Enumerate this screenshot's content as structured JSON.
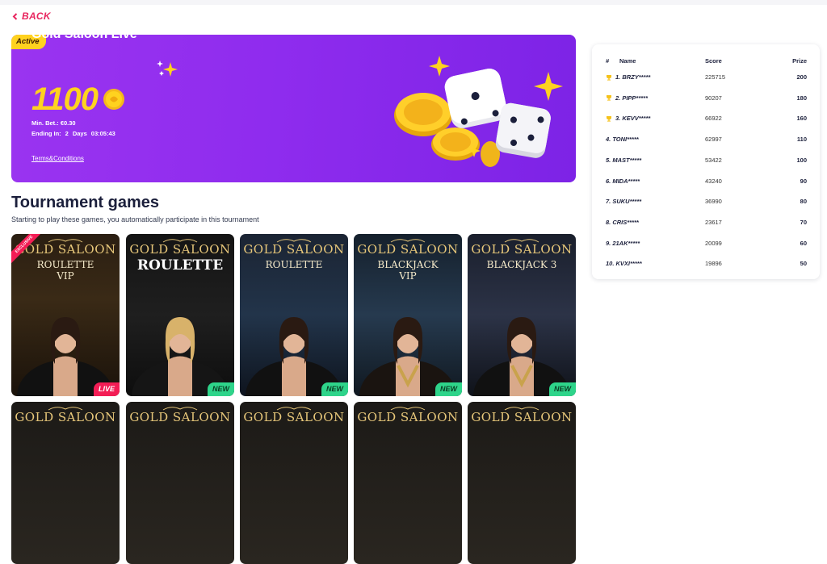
{
  "nav": {
    "back_label": "BACK"
  },
  "banner": {
    "badge": "Active",
    "title": "Gold Saloon Live",
    "amount": "1100",
    "min_bet": "Min. Bet.: €0.30",
    "ending_label": "Ending In:",
    "ending_days": "2",
    "ending_days_unit": "Days",
    "ending_time": "03:05:43",
    "terms_label": "Terms&Conditions"
  },
  "section": {
    "title": "Tournament games",
    "subtitle": "Starting to play these games, you automatically participate in this tournament"
  },
  "games": [
    {
      "brand": "GOLD SALOON",
      "name_line1": "ROULETTE",
      "name_line2": "VIP",
      "tag": "LIVE",
      "ribbon": "EXCLUSIVE"
    },
    {
      "brand": "GOLD SALOON",
      "name_line1": "ROULETTE",
      "name_line2": "",
      "tag": "NEW",
      "ribbon": ""
    },
    {
      "brand": "GOLD SALOON",
      "name_line1": "ROULETTE",
      "name_line2": "",
      "tag": "NEW",
      "ribbon": ""
    },
    {
      "brand": "GOLD SALOON",
      "name_line1": "BLACKJACK",
      "name_line2": "VIP",
      "tag": "NEW",
      "ribbon": ""
    },
    {
      "brand": "GOLD SALOON",
      "name_line1": "BLACKJACK 3",
      "name_line2": "",
      "tag": "NEW",
      "ribbon": ""
    }
  ],
  "more_games_brand": "GOLD SALOON",
  "leaderboard": {
    "headers": {
      "rank": "#",
      "name": "Name",
      "score": "Score",
      "prize": "Prize"
    },
    "rows": [
      {
        "name": "1. BRZY*****",
        "score": "225715",
        "prize": "200",
        "trophy": true
      },
      {
        "name": "2. PIPP*****",
        "score": "90207",
        "prize": "180",
        "trophy": true
      },
      {
        "name": "3. KEVV*****",
        "score": "66922",
        "prize": "160",
        "trophy": true
      },
      {
        "name": "4. TONI*****",
        "score": "62997",
        "prize": "110",
        "trophy": false
      },
      {
        "name": "5. MAST*****",
        "score": "53422",
        "prize": "100",
        "trophy": false
      },
      {
        "name": "6. MIDA*****",
        "score": "43240",
        "prize": "90",
        "trophy": false
      },
      {
        "name": "7. SUKU*****",
        "score": "36990",
        "prize": "80",
        "trophy": false
      },
      {
        "name": "8. CRIS*****",
        "score": "23617",
        "prize": "70",
        "trophy": false
      },
      {
        "name": "9. 21AK*****",
        "score": "20099",
        "prize": "60",
        "trophy": false
      },
      {
        "name": "10. KVXI*****",
        "score": "19896",
        "prize": "50",
        "trophy": false
      }
    ]
  },
  "colors": {
    "accent": "#e8265f",
    "banner_purple": "#9a34f0",
    "gold": "#ffd21f",
    "live_tag": "#f31d55",
    "new_tag": "#2ed48a"
  }
}
